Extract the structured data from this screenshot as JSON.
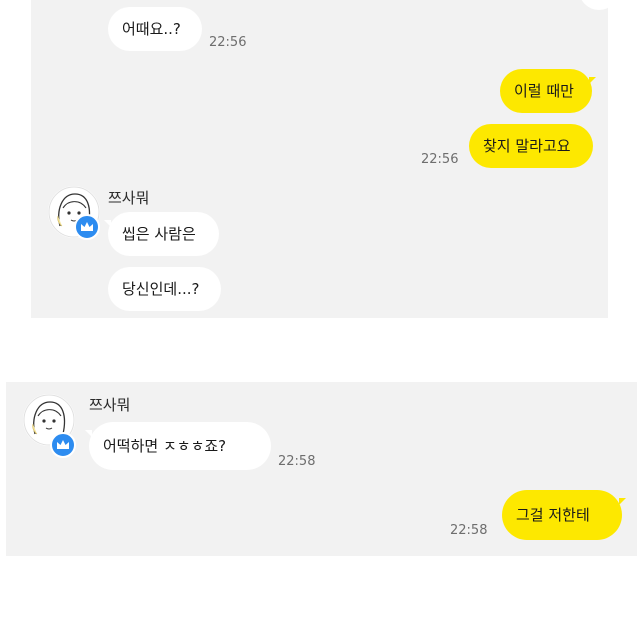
{
  "chat_1": {
    "messages": [
      {
        "text": "어때요..?",
        "time": "22:56"
      },
      {
        "text": "이럴 때만"
      },
      {
        "text": "찾지 말라고요",
        "time": "22:56"
      },
      {
        "sender": "쯔사뭐"
      },
      {
        "text": "씹은 사람은"
      },
      {
        "text": "당신인데...?"
      }
    ]
  },
  "chat_2": {
    "messages": [
      {
        "sender": "쯔사뭐"
      },
      {
        "text": "어떡하면 ㅈㅎㅎ죠?",
        "time": "22:58"
      },
      {
        "text": "그걸 저한테",
        "time": "22:58"
      }
    ]
  },
  "icons": {
    "avatar": "girl-portrait-icon",
    "badge": "crown-icon"
  },
  "colors": {
    "background": "#f2f2f2",
    "outgoing_bubble": "#fde800",
    "incoming_bubble": "#ffffff",
    "badge": "#2d8cf0"
  }
}
